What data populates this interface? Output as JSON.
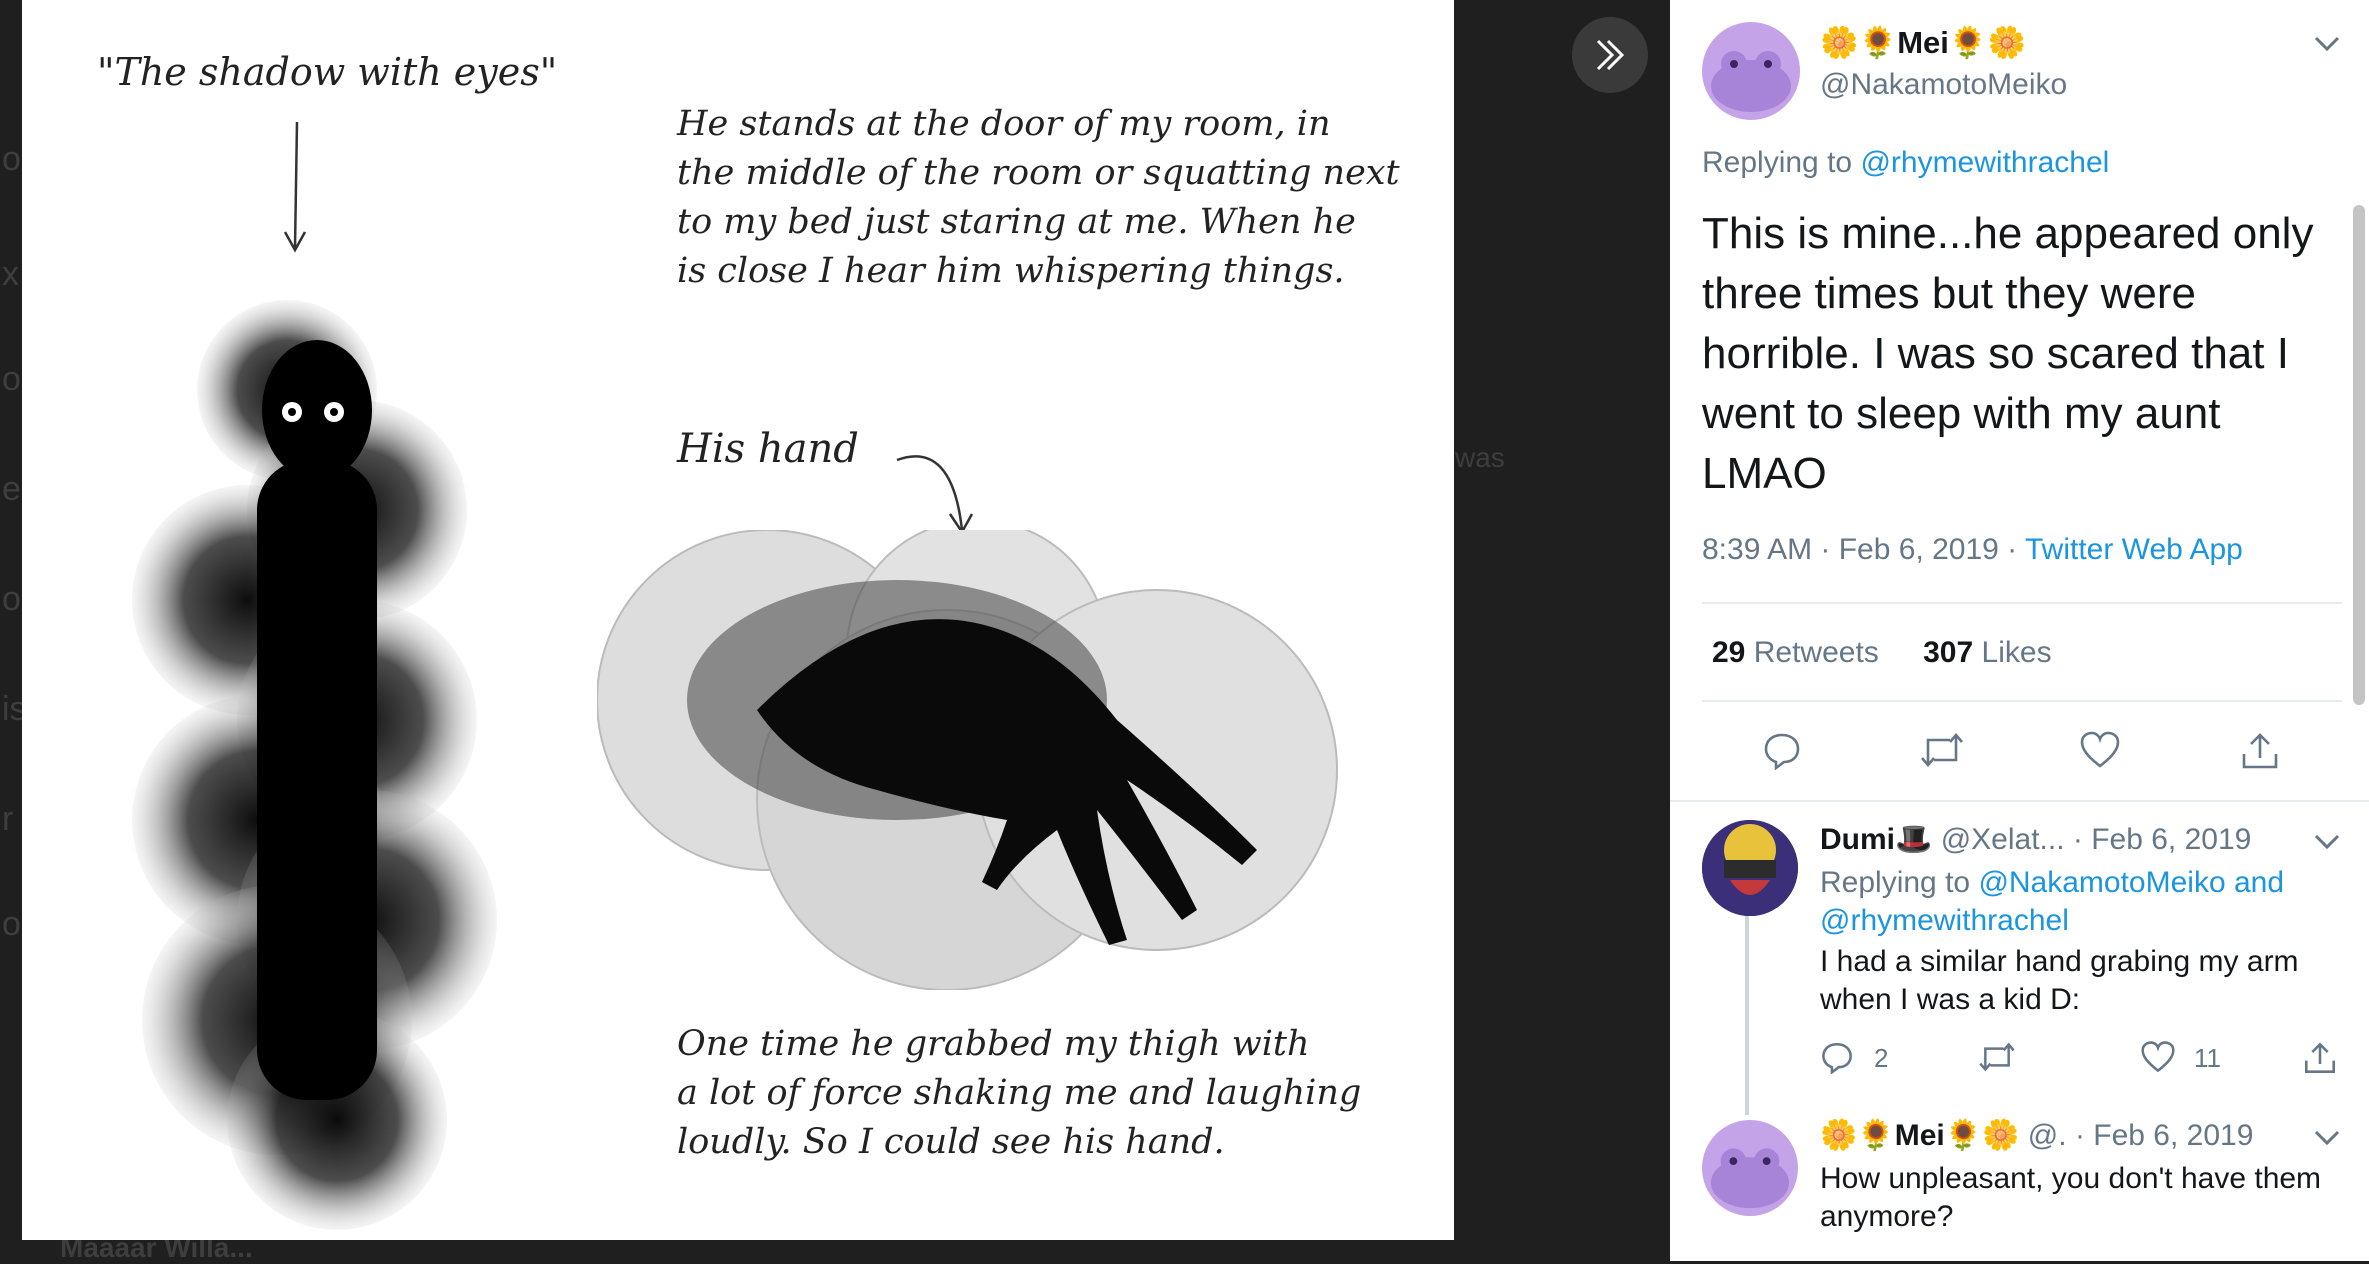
{
  "background": {
    "ghost_fragments": [
      "o",
      "x",
      "o",
      "e",
      "o",
      "is",
      "r",
      "o",
      "was",
      "Maaaar Willa..."
    ]
  },
  "media": {
    "caption_title": "\"The shadow with eyes\"",
    "description": "He stands at the door of my room, in\nthe middle of the room or squatting next\nto my bed just staring at me. When he\nis close I hear him whispering things.",
    "hand_label": "His hand",
    "story": "One time he grabbed my thigh with\na lot of force shaking me and laughing\nloudly. So I could see his hand.",
    "next_icon": "double-chevron-right-icon"
  },
  "tweet": {
    "display_name": "Mei",
    "name_emoji_left": "🌼🌻",
    "name_emoji_right": "🌻🌼",
    "handle": "@NakamotoMeiko",
    "replying_prefix": "Replying to",
    "replying_to": "@rhymewithrachel",
    "text": "This is mine...he appeared only three times but they were horrible. I was so scared that I went to sleep with my aunt LMAO",
    "time": "8:39 AM · Feb 6, 2019 ·",
    "source": "Twitter Web App",
    "retweets_count": "29",
    "retweets_label": "Retweets",
    "likes_count": "307",
    "likes_label": "Likes",
    "accent": "#1b95e0"
  },
  "replies": [
    {
      "display_name": "Dumi",
      "name_emoji": "🎩",
      "handle": "@Xelat...",
      "date": "· Feb 6, 2019",
      "replying_prefix": "Replying to",
      "replying_to_1": "@NakamotoMeiko",
      "and_word": "and",
      "replying_to_2": "@rhymewithrachel",
      "text": "I had a similar hand grabing my arm when I was a kid D:",
      "reply_count": "2",
      "retweet_count": "",
      "like_count": "11"
    },
    {
      "display_name": "Mei",
      "name_emoji_left": "🌼🌻",
      "name_emoji_right": "🌻🌼",
      "handle": "@.",
      "date": "· Feb 6, 2019",
      "text": "How unpleasant, you don't have them anymore?"
    }
  ]
}
